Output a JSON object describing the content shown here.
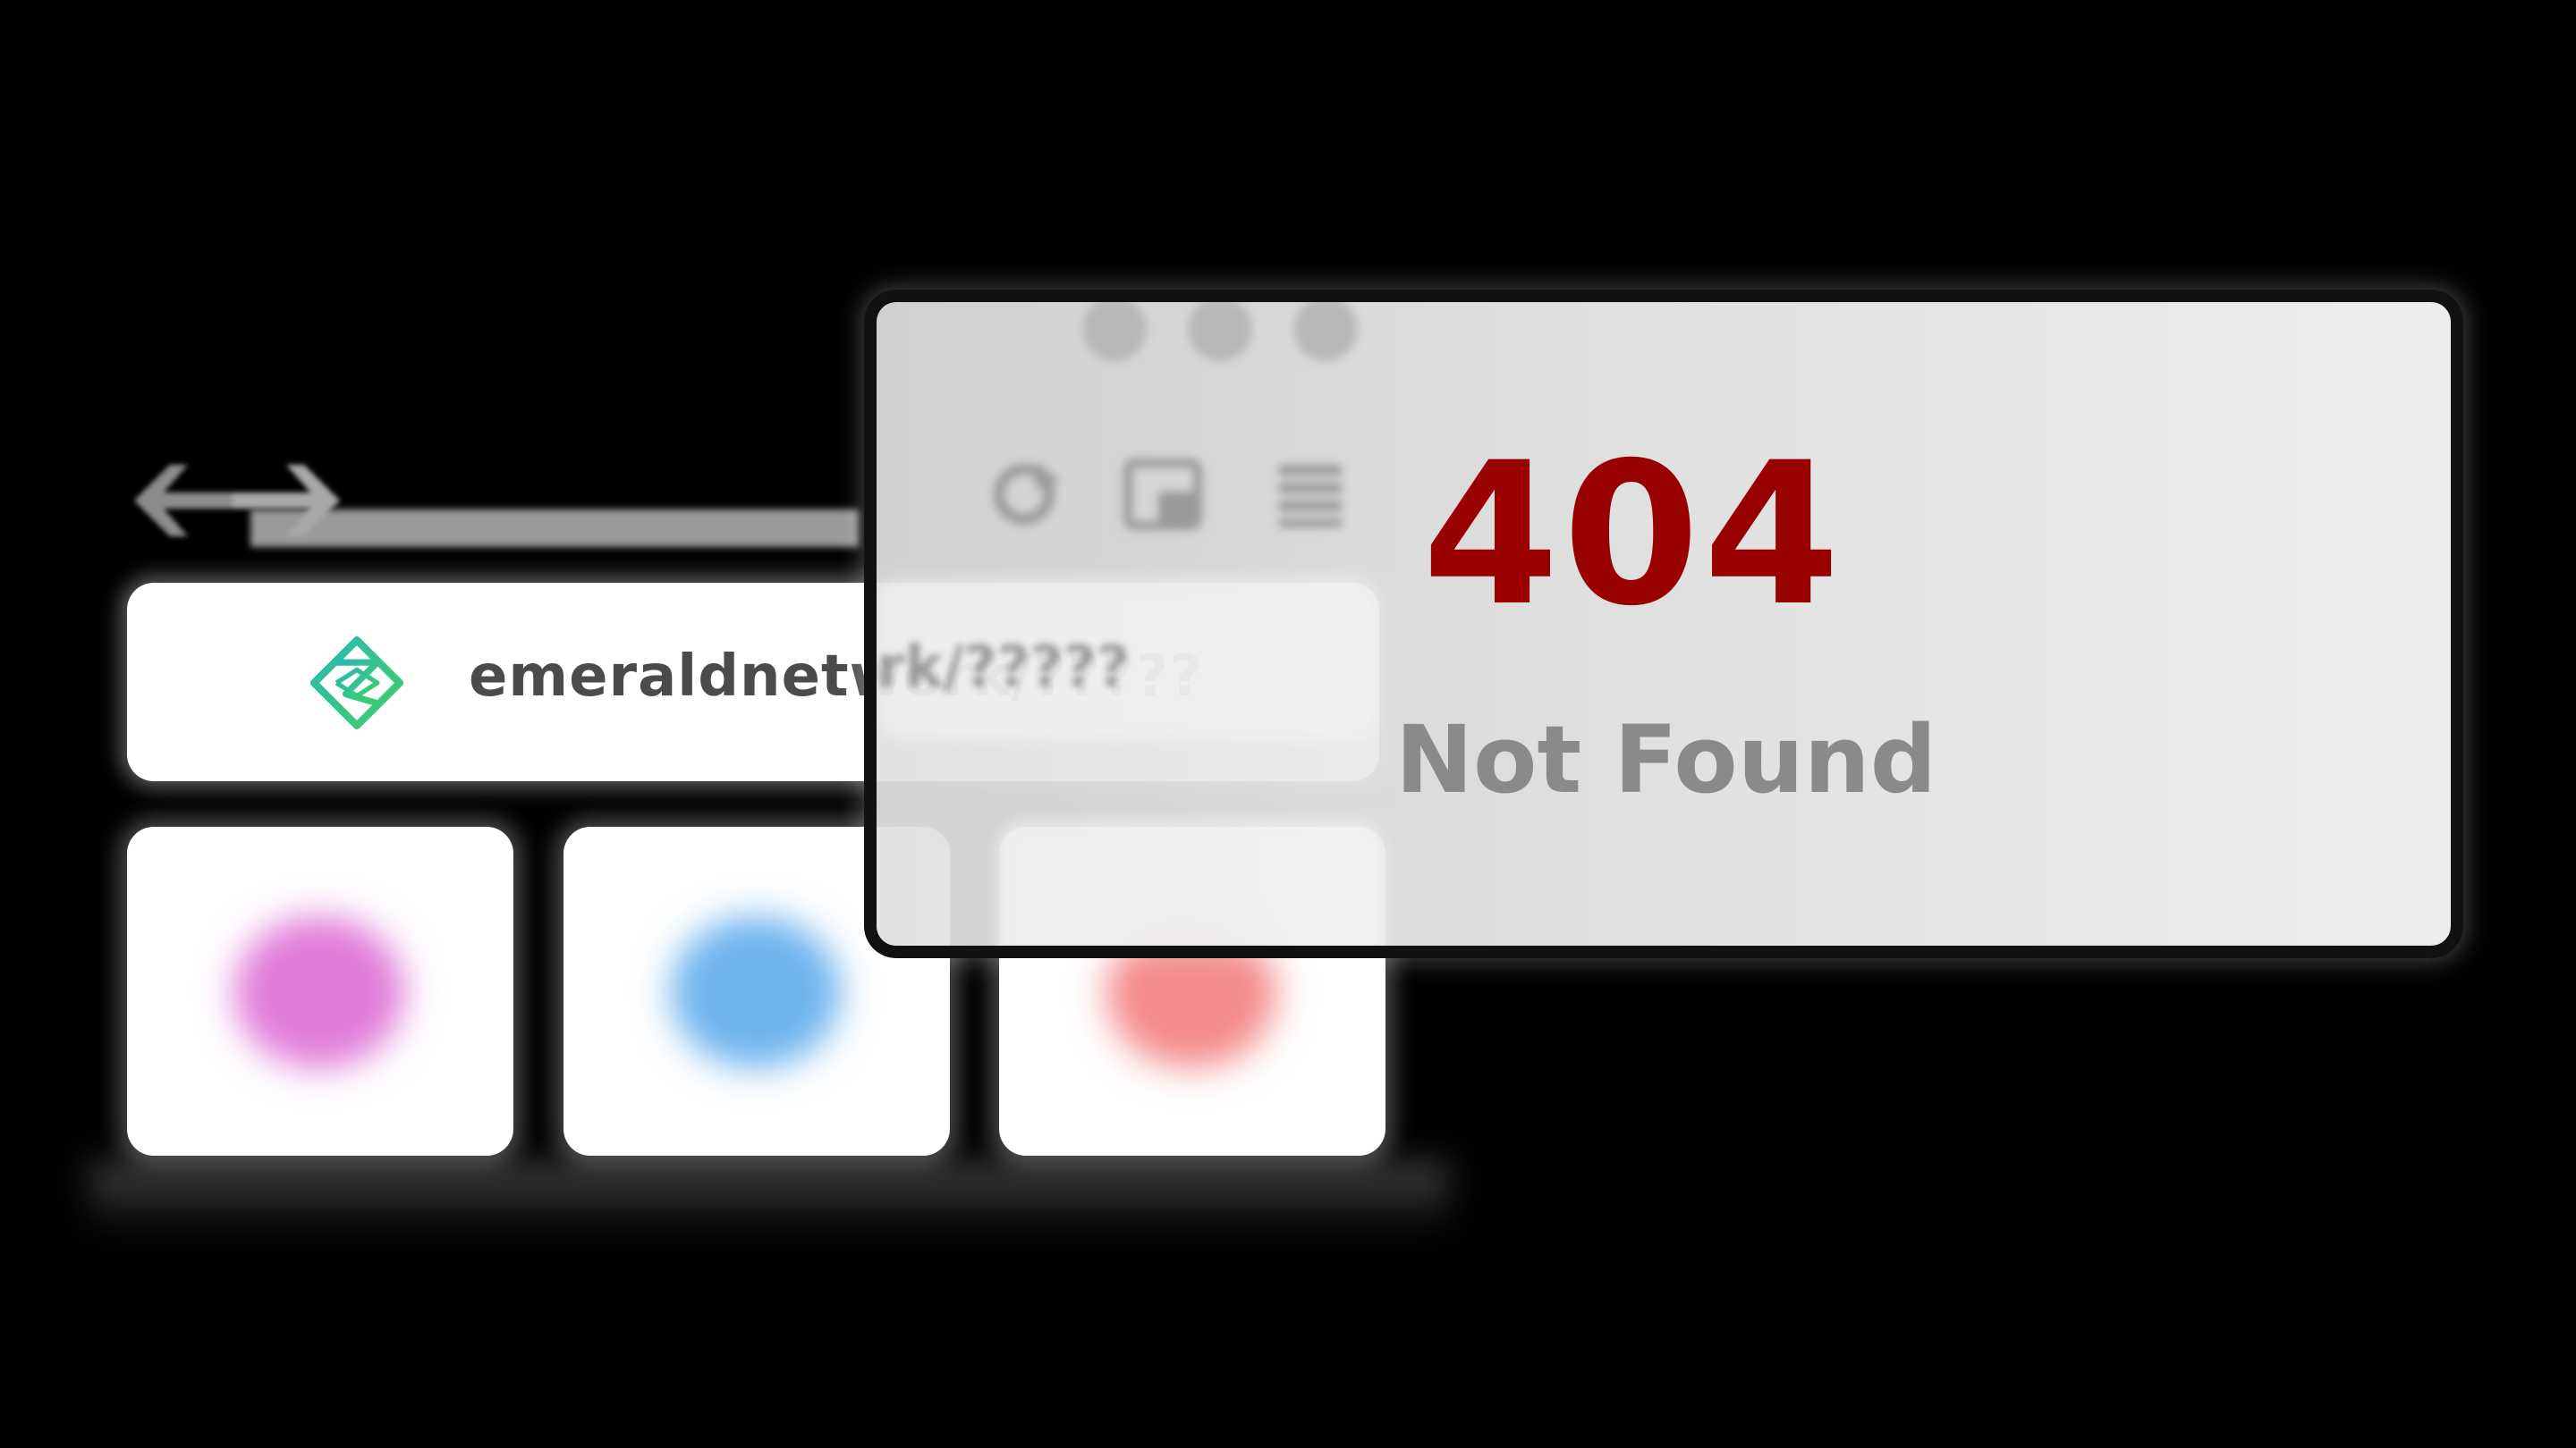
{
  "address_bar": {
    "url": "emeraldnetwork/?????",
    "logo": "emerald-network-logo-icon"
  },
  "nav": {
    "back_icon": "arrow-left-icon",
    "forward_icon": "arrow-right-icon"
  },
  "tiles": [
    {
      "blob_color": "#e07ad8"
    },
    {
      "blob_color": "#6db3ee"
    },
    {
      "blob_color": "#f48a8a"
    }
  ],
  "window_controls": [
    "close-dot",
    "minimize-dot",
    "maximize-dot"
  ],
  "toolbar_icons": [
    "reload-icon",
    "window-icon",
    "menu-icon"
  ],
  "error": {
    "code": "404",
    "message": "Not Found"
  },
  "colors": {
    "error_code": "#990000",
    "error_message": "#8a8a8a",
    "logo_gradient_start": "#2ab8b0",
    "logo_gradient_end": "#3fcf6a"
  }
}
